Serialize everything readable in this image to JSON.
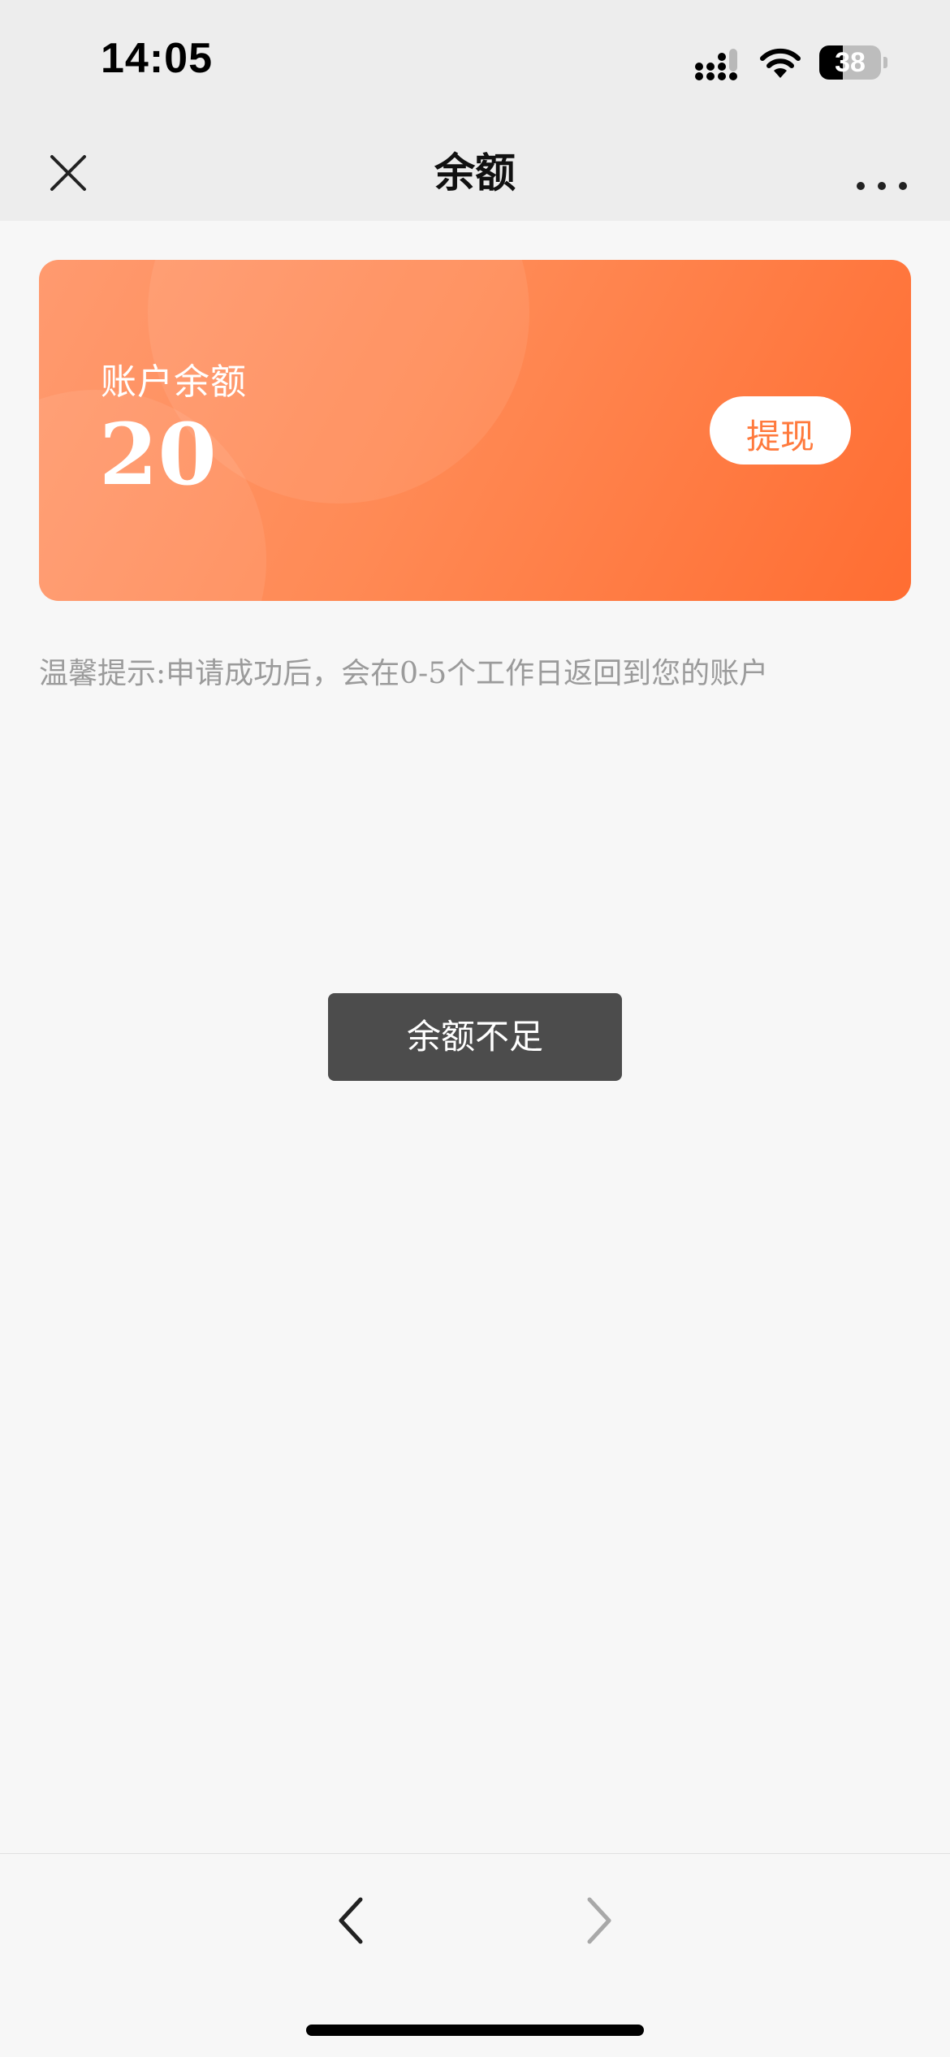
{
  "status_bar": {
    "time": "14:05",
    "battery_level": "38",
    "battery_percent": 38,
    "icons": [
      "signal-icon",
      "wifi-icon",
      "battery-icon"
    ]
  },
  "nav": {
    "title": "余额",
    "close_icon": "close-icon",
    "more_icon": "more-dots-icon"
  },
  "card": {
    "label": "账户余额",
    "amount": "20",
    "withdraw_label": "提现",
    "gradient_colors": [
      "#ff9a6f",
      "#ff6d32"
    ]
  },
  "tip": "温馨提示:申请成功后，会在0-5个工作日返回到您的账户",
  "toast": {
    "message": "余额不足"
  },
  "toolbar": {
    "back_icon": "chevron-left-icon",
    "forward_icon": "chevron-right-icon"
  },
  "colors": {
    "accent": "#ff7a3d",
    "nav_background": "#ededed",
    "page_background": "#f7f7f7",
    "toast_background": "#4c4c4c",
    "tip_text": "#9b9b9b"
  }
}
